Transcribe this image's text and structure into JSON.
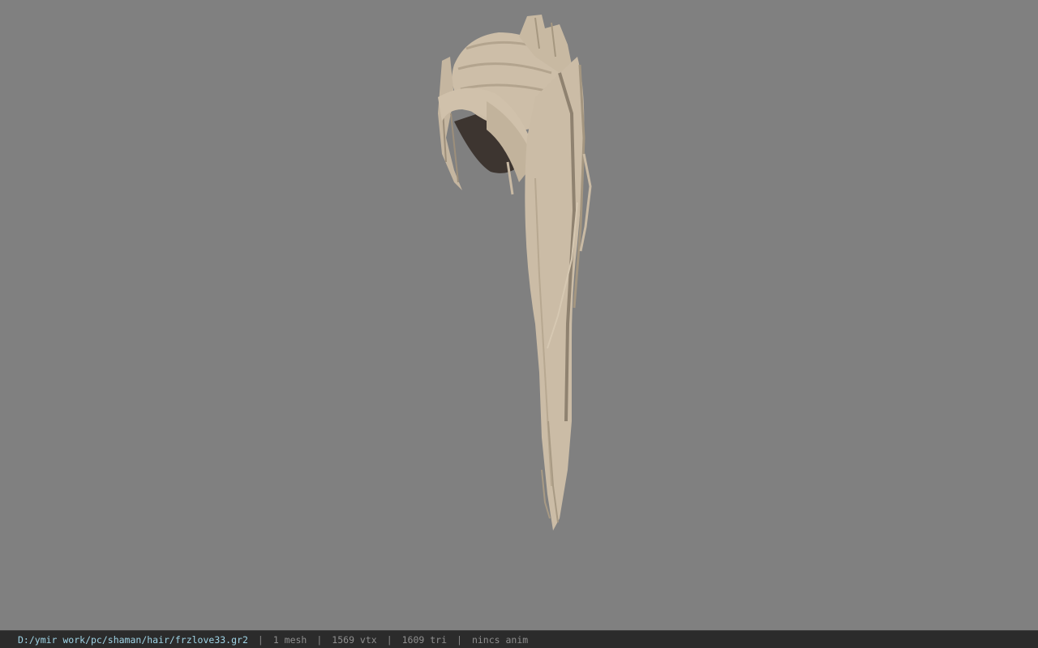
{
  "viewport": {
    "background": "#808080",
    "model": {
      "name": "hair-model",
      "base_color": "#cbbba4",
      "shade_color": "#9d8f7b",
      "dark_color": "#3b3430"
    }
  },
  "statusbar": {
    "path": "D:/ymir work/pc/shaman/hair/frzlove33.gr2",
    "sep": "|",
    "mesh": "1 mesh",
    "vtx": "1569 vtx",
    "tri": "1609 tri",
    "anim": "nincs anim",
    "path_color": "#9fd4e6"
  }
}
